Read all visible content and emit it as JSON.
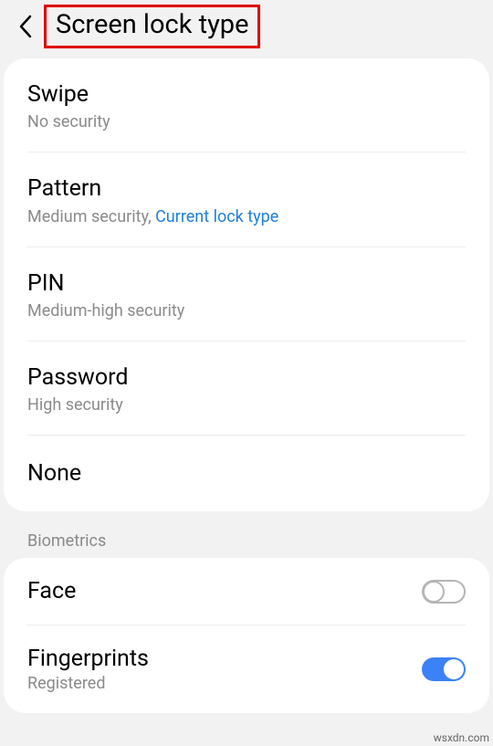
{
  "header": {
    "title": "Screen lock type"
  },
  "lock_types": {
    "swipe": {
      "title": "Swipe",
      "sub": "No security"
    },
    "pattern": {
      "title": "Pattern",
      "sub_pre": "Medium security, ",
      "sub_link": "Current lock type"
    },
    "pin": {
      "title": "PIN",
      "sub": "Medium-high security"
    },
    "password": {
      "title": "Password",
      "sub": "High security"
    },
    "none": {
      "title": "None"
    }
  },
  "biometrics": {
    "header": "Biometrics",
    "face": {
      "title": "Face",
      "enabled": false
    },
    "fingerprints": {
      "title": "Fingerprints",
      "sub": "Registered",
      "enabled": true
    }
  },
  "watermark": "wsxdn.com"
}
